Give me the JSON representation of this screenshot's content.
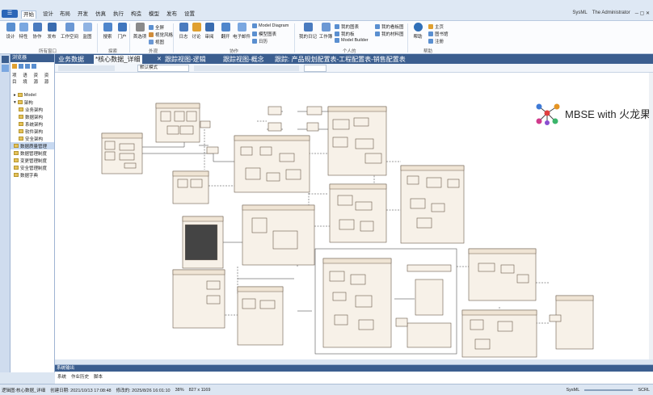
{
  "app": {
    "user": "The Administrator",
    "profile": "SysML"
  },
  "menu": [
    "开始",
    "设计",
    "布局",
    "开发",
    "仿真",
    "执行",
    "构造",
    "模型",
    "发布",
    "设置"
  ],
  "ribbon": {
    "buttons": [
      "设计",
      "特性",
      "协作",
      "发布",
      "工作空间",
      "监图",
      "搜索",
      "门户",
      "首选项",
      "日志",
      "讨论",
      "审阅",
      "翻开",
      "电子邮件"
    ],
    "outline": [
      "全屏",
      "视觉风格",
      "视图"
    ],
    "small": [
      "Model Diagram",
      "模型图表",
      "日历",
      "我的日记",
      "工作簿",
      "我的图表",
      "我的板",
      "Model Builder",
      "我的看板图",
      "我的材料图",
      "帮助",
      "主页",
      "图书馆",
      "注册"
    ],
    "groups": [
      "所有窗口",
      "探索",
      "外观",
      "协作",
      "个人的",
      "帮助"
    ]
  },
  "browser": {
    "title": "浏览器",
    "tabs": [
      "项目",
      "语境",
      "资源",
      "资源"
    ],
    "tree": [
      "Model",
      "架构",
      "业务架构",
      "数据架构",
      "系统架构",
      "软件架构",
      "安全架构",
      "数据质量管理",
      "数据管理制度",
      "变更管理制度",
      "安全管理制度",
      "数据字典"
    ]
  },
  "doctabs": [
    "业务数据",
    "*核心数据_详细",
    "跟踪视图-逻辑",
    "跟踪视图-概念",
    "跟踪: 产品规划配置表-工程配置表-销售配置表"
  ],
  "toolbar": {
    "mode": "默认模式"
  },
  "logo": {
    "text": "MBSE with 火龙果科技"
  },
  "output": {
    "title": "系统输出",
    "tabs": [
      "系统",
      "作业历史",
      "脚本"
    ]
  },
  "status": {
    "diagram": "逻辑图:核心数据_详细",
    "created": "创建日期: 2021/10/13 17:08:48",
    "modified": "修改的: 2025/8/26 16:01:10",
    "zoom": "38%",
    "size": "827 x 1169",
    "profile": "SysML",
    "scrl": "SCRL"
  },
  "colors": {
    "primary": "#3b5e8f",
    "ribbon_bg": "#fbfcfe",
    "block_fill": "#f7f1e8"
  }
}
